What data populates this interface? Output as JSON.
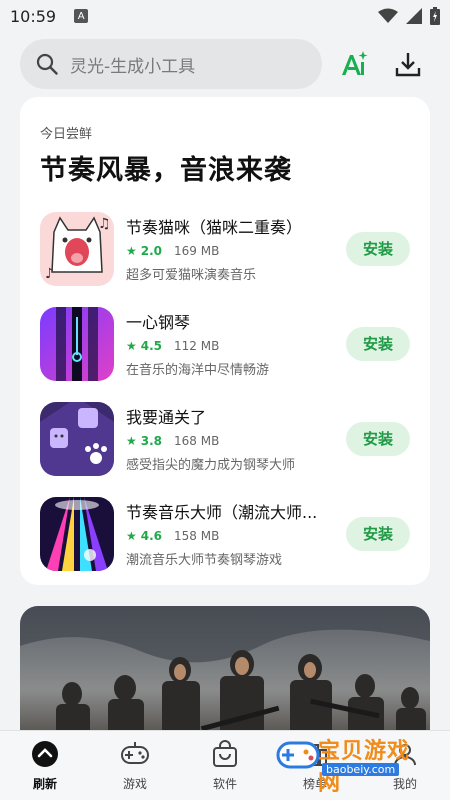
{
  "status_bar": {
    "time": "10:59",
    "notification_letter": "A"
  },
  "search": {
    "placeholder": "灵光-生成小工具"
  },
  "featured": {
    "subtitle": "今日尝鲜",
    "title": "节奏风暴，音浪来袭",
    "apps": [
      {
        "name": "节奏猫咪（猫咪二重奏）",
        "rating": "2.0",
        "size": "169 MB",
        "desc": "超多可爱猫咪演奏音乐",
        "install_label": "安装"
      },
      {
        "name": "一心钢琴",
        "rating": "4.5",
        "size": "112 MB",
        "desc": "在音乐的海洋中尽情畅游",
        "install_label": "安装"
      },
      {
        "name": "我要通关了",
        "rating": "3.8",
        "size": "168 MB",
        "desc": "感受指尖的魔力成为钢琴大师",
        "install_label": "安装"
      },
      {
        "name": "节奏音乐大师（潮流大师...",
        "rating": "4.6",
        "size": "158 MB",
        "desc": "潮流音乐大师节奏钢琴游戏",
        "install_label": "安装"
      }
    ]
  },
  "bottom_nav": {
    "items": [
      {
        "label": "刷新",
        "icon": "refresh-up-icon"
      },
      {
        "label": "游戏",
        "icon": "gamepad-icon"
      },
      {
        "label": "软件",
        "icon": "shopping-bag-icon"
      },
      {
        "label": "榜单",
        "icon": "ranking-icon"
      },
      {
        "label": "我的",
        "icon": "profile-icon"
      }
    ]
  },
  "watermark": {
    "text": "宝贝游戏网",
    "url": "baobeiy.com"
  },
  "colors": {
    "accent_green": "#20a94a",
    "install_bg": "#dff3e3",
    "ai_green": "#17b04f"
  }
}
